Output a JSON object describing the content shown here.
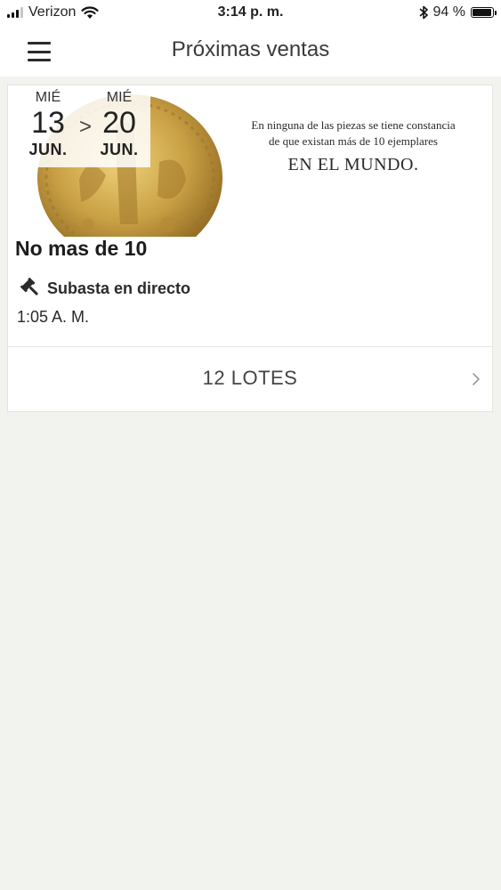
{
  "status_bar": {
    "carrier": "Verizon",
    "time": "3:14 p. m.",
    "battery_text": "94 %",
    "battery_level": 0.94,
    "signal_bars": 3,
    "signal_max": 4,
    "icons": [
      "signal-icon",
      "wifi-icon",
      "bluetooth-icon",
      "battery-icon"
    ]
  },
  "nav": {
    "title": "Próximas ventas",
    "menu_icon": "hamburger-menu-icon"
  },
  "sale": {
    "start": {
      "weekday": "MIÉ",
      "day": "13",
      "month": "JUN."
    },
    "separator": ">",
    "end": {
      "weekday": "MIÉ",
      "day": "20",
      "month": "JUN."
    },
    "banner": {
      "line1": "En ninguna de las piezas se tiene constancia",
      "line2": "de que existan más de 10 ejemplares",
      "headline": "EN EL MUNDO."
    },
    "title": "No mas de 10",
    "type_icon": "gavel-icon",
    "type_label": "Subasta en directo",
    "time": "1:05 A. M.",
    "lots_label": "12 LOTES",
    "lots_icon": "chevron-right-icon"
  },
  "colors": {
    "background": "#f2f2ee",
    "surface": "#ffffff",
    "coin_gold": "#c9a044",
    "text": "#222222"
  }
}
